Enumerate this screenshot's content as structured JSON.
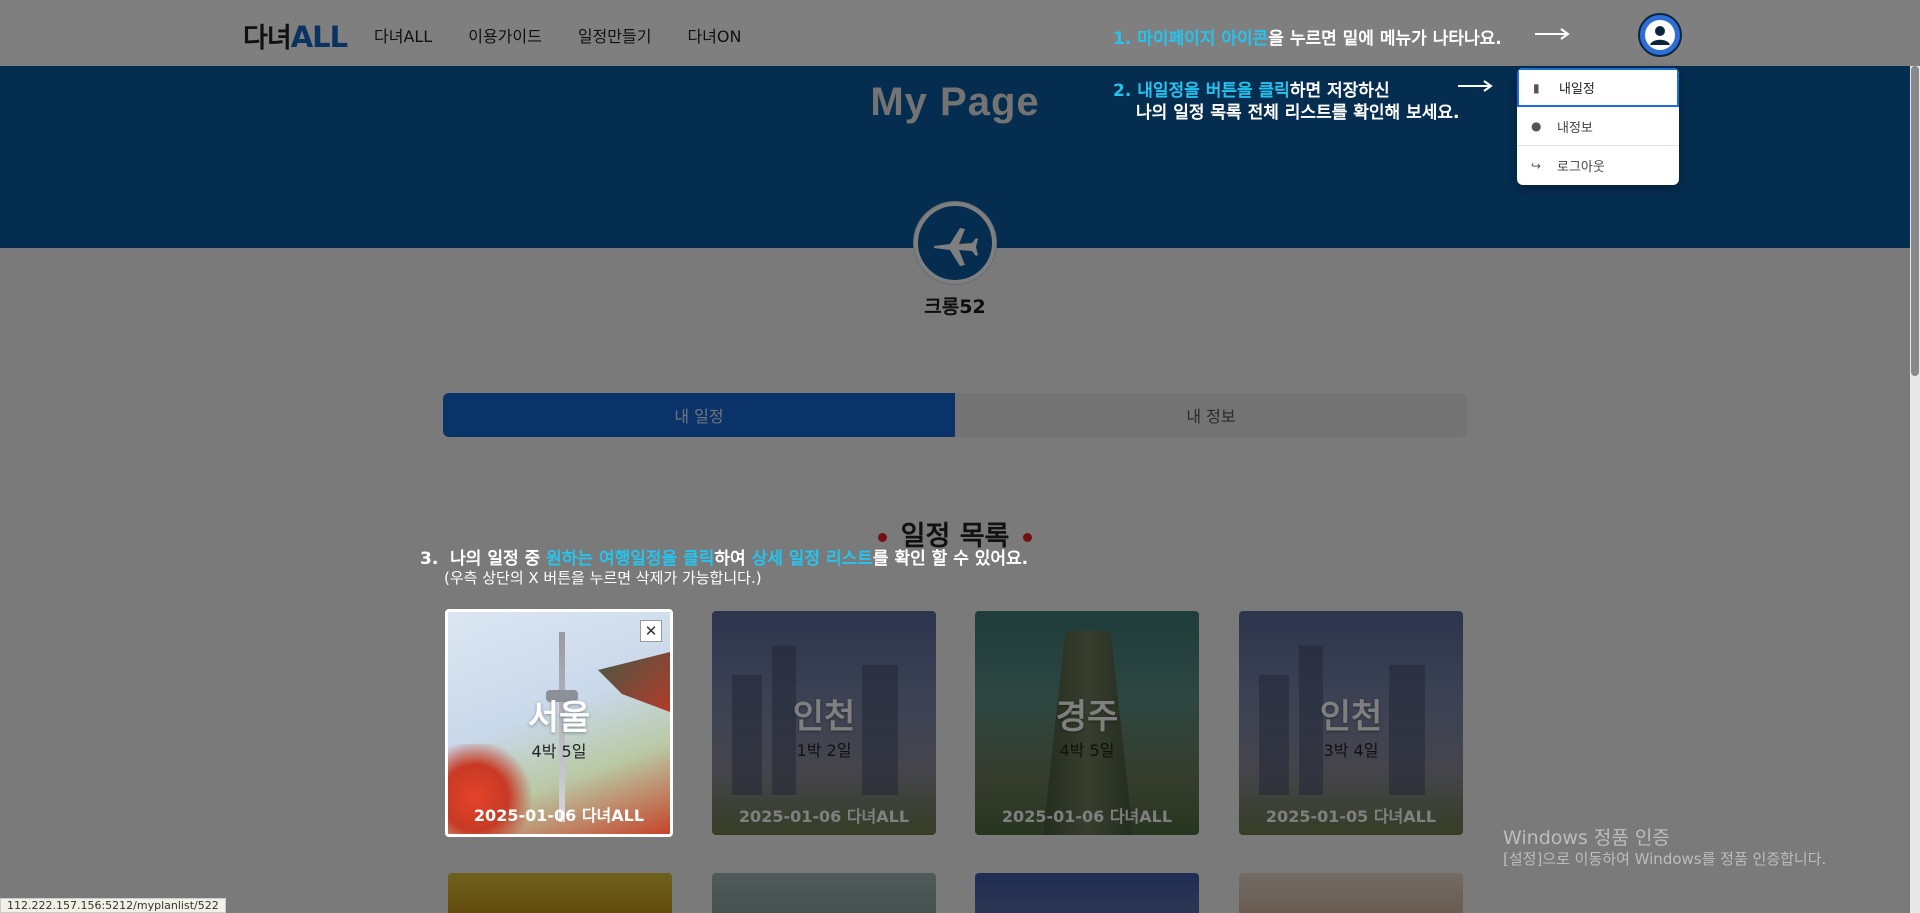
{
  "header": {
    "logo_main": "다녀",
    "logo_accent": "ALL",
    "nav": [
      "다녀ALL",
      "이용가이드",
      "일정만들기",
      "다녀ON"
    ],
    "avatar_icon": "user-circle-icon"
  },
  "hero": {
    "title": "My Page"
  },
  "profile": {
    "username": "크롱52",
    "icon": "airplane-icon"
  },
  "tabs": {
    "active": "내 일정",
    "inactive": "내 정보"
  },
  "section": {
    "title": "일정 목록"
  },
  "dropdown": {
    "items": [
      {
        "label": "내일정",
        "icon": "bag-icon"
      },
      {
        "label": "내정보",
        "icon": "person-icon"
      },
      {
        "label": "로그아웃",
        "icon": "logout-icon"
      }
    ]
  },
  "cards": [
    {
      "city": "서울",
      "duration": "4박 5일",
      "footer": "2025-01-06 다녀ALL",
      "close": "✕"
    },
    {
      "city": "인천",
      "duration": "1박 2일",
      "footer": "2025-01-06 다녀ALL"
    },
    {
      "city": "경주",
      "duration": "4박 5일",
      "footer": "2025-01-06 다녀ALL"
    },
    {
      "city": "인천",
      "duration": "3박 4일",
      "footer": "2025-01-05 다녀ALL"
    }
  ],
  "annotations": {
    "step1": {
      "num": "1.",
      "hl": "마이페이지 아이콘",
      "rest": "을 누르면  밑에 메뉴가 나타나요."
    },
    "step2": {
      "num": "2.",
      "hl": "내일정을 버튼을 클릭",
      "rest": "하면 저장하신",
      "line2": "나의 일정 목록 전체 리스트를 확인해 보세요."
    },
    "step3": {
      "num": "3.",
      "pre": "나의 일정 중 ",
      "hl1": "원하는 여행일정을 클릭",
      "mid": "하여 ",
      "hl2": "상세 일정 리스트",
      "rest": "를 확인 할  수 있어요.",
      "line2": "(우측 상단의  X 버튼을 누르면 삭제가 가능합니다.)"
    }
  },
  "windows": {
    "title": "Windows 정품 인증",
    "sub": "[설정]으로 이동하여 Windows를 정품 인증합니다."
  },
  "status_url": "112.222.157.156:5212/myplanlist/522",
  "colors": {
    "primary": "#1466d2",
    "hero": "#0b5aa0",
    "highlight": "#25c4f0"
  }
}
